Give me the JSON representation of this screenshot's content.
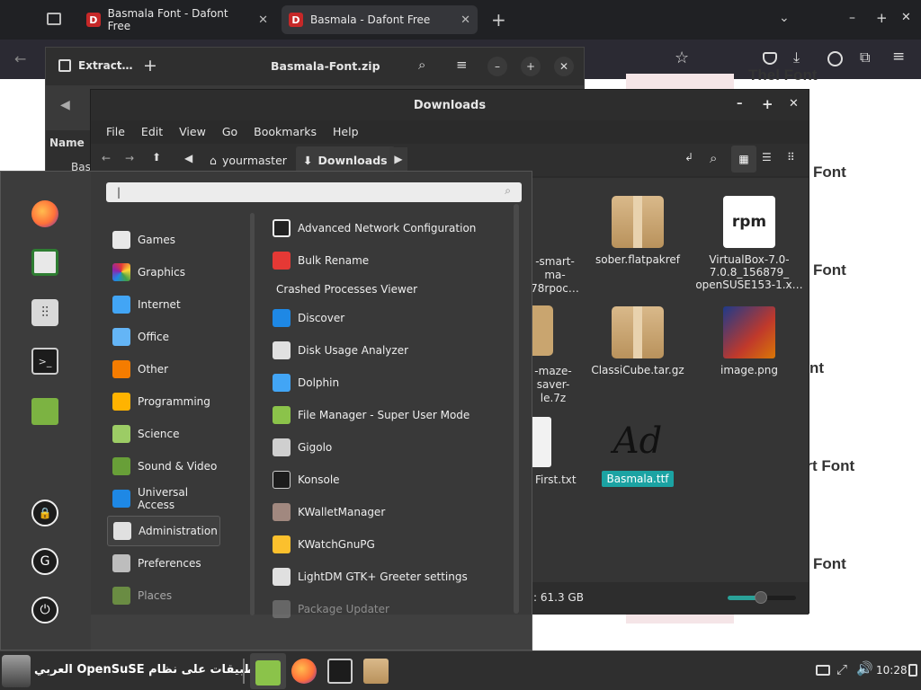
{
  "browser": {
    "tabs": [
      {
        "title": "Basmala Font - Dafont Free",
        "favicon": "D"
      },
      {
        "title": "Basmala - Dafont Free",
        "favicon": "D"
      }
    ],
    "window_controls": {
      "min": "–",
      "max": "+",
      "close": "✕"
    }
  },
  "web": {
    "headings": [
      "Thel Font",
      "Font",
      "Font",
      "nt",
      "ort Font",
      "Font"
    ]
  },
  "archive": {
    "tab_label": "Extract…",
    "title": "Basmala-Font.zip",
    "column_name": "Name",
    "row_label": "Bas"
  },
  "files": {
    "title": "Downloads",
    "menu": [
      "File",
      "Edit",
      "View",
      "Go",
      "Bookmarks",
      "Help"
    ],
    "crumbs": [
      "yourmaster",
      "Downloads"
    ],
    "items": [
      {
        "label_lines": [
          "sober.flatpakref"
        ],
        "icon": "package-icon"
      },
      {
        "label_lines": [
          "VirtualBox-7.0-",
          "7.0.8_156879_",
          "openSUSE153-1.x…"
        ],
        "icon": "rpm-icon"
      },
      {
        "label_lines": [
          "ClassiCube.tar.gz"
        ],
        "icon": "package-icon"
      },
      {
        "label_lines": [
          "image.png"
        ],
        "icon": "image-icon"
      },
      {
        "label_lines": [
          "Basmala.ttf"
        ],
        "icon": "font-icon",
        "selected": true
      },
      {
        "label_lines": [
          "-smart-",
          "ma-",
          "78rpoc…"
        ],
        "icon": "partial"
      },
      {
        "label_lines": [
          "-maze-",
          "saver-",
          "le.7z"
        ],
        "icon": "partial"
      },
      {
        "label_lines": [
          "First.txt"
        ],
        "icon": "text-icon"
      }
    ],
    "status_free": ": 61.3 GB",
    "font_glyph": "Ad"
  },
  "launcher": {
    "search_value": "|",
    "categories": [
      "Games",
      "Graphics",
      "Internet",
      "Office",
      "Other",
      "Programming",
      "Science",
      "Sound & Video",
      "Universal Access",
      "Administration",
      "Preferences",
      "Places"
    ],
    "selected_category": "Administration",
    "apps": [
      "Advanced Network Configuration",
      "Bulk Rename",
      "Crashed Processes Viewer",
      "Discover",
      "Disk Usage Analyzer",
      "Dolphin",
      "File Manager - Super User Mode",
      "Gigolo",
      "Konsole",
      "KWalletManager",
      "KWatchGnuPG",
      "LightDM GTK+ Greeter settings",
      "Package Updater"
    ]
  },
  "taskbar": {
    "channel_text": "تطبيقات على نظام OpenSuSE العربي",
    "clock": "10:28"
  },
  "colors": {
    "accent": "#2aa198",
    "selection": "#1ba3a3",
    "dark_bg": "#2b2b2b"
  }
}
